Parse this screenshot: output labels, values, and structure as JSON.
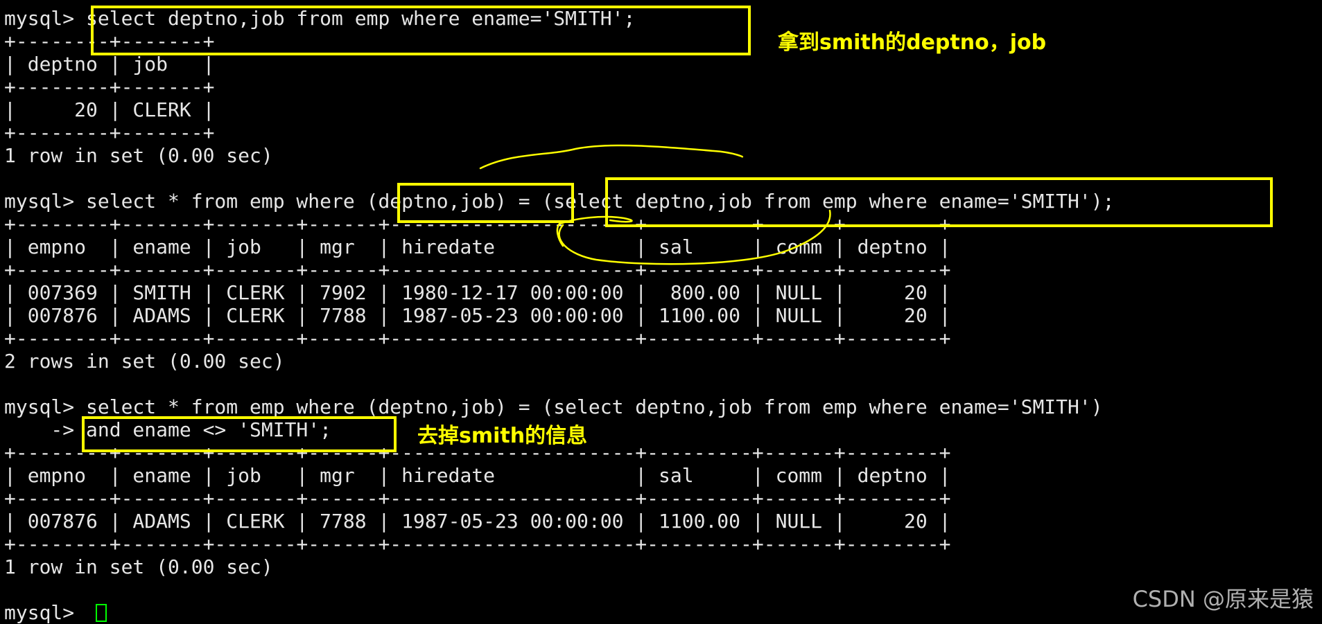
{
  "terminal": {
    "lines": [
      "mysql> select deptno,job from emp where ename='SMITH';",
      "+--------+-------+",
      "| deptno | job   |",
      "+--------+-------+",
      "|     20 | CLERK |",
      "+--------+-------+",
      "1 row in set (0.00 sec)",
      "",
      "mysql> select * from emp where (deptno,job) = (select deptno,job from emp where ename='SMITH');",
      "+--------+-------+-------+------+---------------------+---------+------+--------+",
      "| empno  | ename | job   | mgr  | hiredate            | sal     | comm | deptno |",
      "+--------+-------+-------+------+---------------------+---------+------+--------+",
      "| 007369 | SMITH | CLERK | 7902 | 1980-12-17 00:00:00 |  800.00 | NULL |     20 |",
      "| 007876 | ADAMS | CLERK | 7788 | 1987-05-23 00:00:00 | 1100.00 | NULL |     20 |",
      "+--------+-------+-------+------+---------------------+---------+------+--------+",
      "2 rows in set (0.00 sec)",
      "",
      "mysql> select * from emp where (deptno,job) = (select deptno,job from emp where ename='SMITH')",
      "    -> and ename <> 'SMITH';",
      "+--------+-------+-------+------+---------------------+---------+------+--------+",
      "| empno  | ename | job   | mgr  | hiredate            | sal     | comm | deptno |",
      "+--------+-------+-------+------+---------------------+---------+------+--------+",
      "| 007876 | ADAMS | CLERK | 7788 | 1987-05-23 00:00:00 | 1100.00 | NULL |     20 |",
      "+--------+-------+-------+------+---------------------+---------+------+--------+",
      "1 row in set (0.00 sec)",
      "",
      "mysql> "
    ]
  },
  "annotations": {
    "note1": "拿到smith的deptno，job",
    "note2": "去掉smith的信息",
    "highlight_color": "#ffff00"
  },
  "watermark": "CSDN @原来是猿",
  "cursor_color": "#00ff00"
}
